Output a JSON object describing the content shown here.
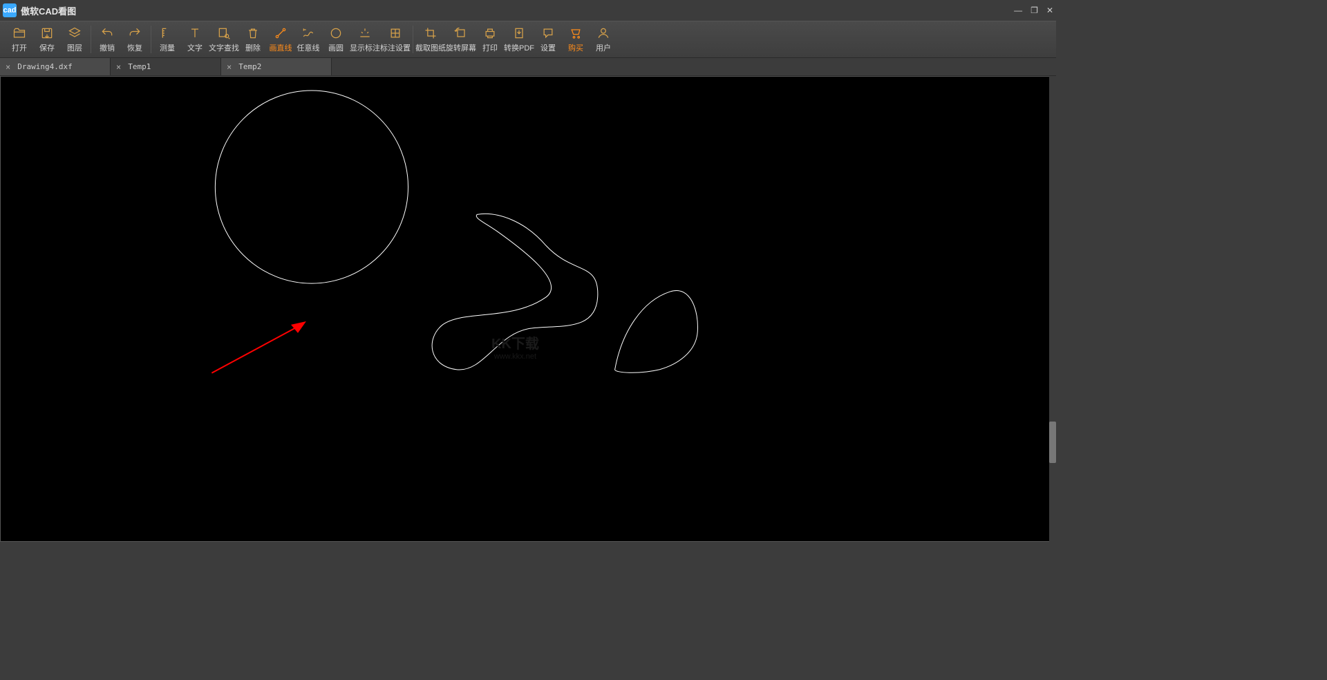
{
  "app": {
    "icon_text": "cad",
    "title": "傲软CAD看图"
  },
  "window_controls": {
    "minimize": "—",
    "restore": "❐",
    "close": "✕"
  },
  "toolbar": {
    "open": "打开",
    "save": "保存",
    "layer": "图层",
    "undo": "撤销",
    "redo": "恢复",
    "measure": "测量",
    "text": "文字",
    "text_search": "文字查找",
    "delete": "删除",
    "draw_line": "画直线",
    "any_line": "任意线",
    "circle": "画圆",
    "show_mark": "显示标注",
    "mark_settings": "标注设置",
    "crop": "截取图纸",
    "rotate": "旋转屏幕",
    "print": "打印",
    "to_pdf": "转换PDF",
    "settings": "设置",
    "buy": "购买",
    "user": "用户"
  },
  "tabs": [
    {
      "label": "Drawing4.dxf",
      "active": false
    },
    {
      "label": "Temp1",
      "active": true
    },
    {
      "label": "Temp2",
      "active": false
    }
  ],
  "watermark": {
    "main": "KK下载",
    "sub": "www.kkx.net"
  }
}
